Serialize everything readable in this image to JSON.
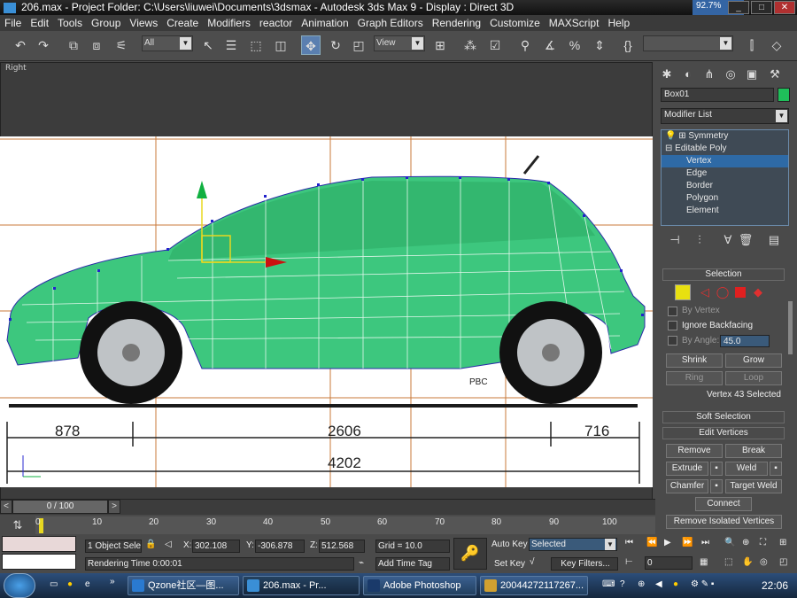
{
  "window": {
    "title": "206.max   - Project Folder: C:\\Users\\liuwei\\Documents\\3dsmax     - Autodesk 3ds Max 9      - Display : Direct 3D",
    "percent": "92.7%"
  },
  "menu": [
    "File",
    "Edit",
    "Tools",
    "Group",
    "Views",
    "Create",
    "Modifiers",
    "reactor",
    "Animation",
    "Graph Editors",
    "Rendering",
    "Customize",
    "MAXScript",
    "Help"
  ],
  "toolbar": {
    "filter": "All",
    "ref_coord": "View"
  },
  "viewport": {
    "label": "Right",
    "dimensions": {
      "front": "878",
      "wheelbase": "2606",
      "rear": "716",
      "total": "4202"
    },
    "plate": "PBC"
  },
  "panel": {
    "object_name": "Box01",
    "object_color": "#1fbf5a",
    "modifier_list": "Modifier List",
    "stack": [
      {
        "label": "Symmetry"
      },
      {
        "label": "Editable Poly"
      },
      {
        "label": "Vertex"
      },
      {
        "label": "Edge"
      },
      {
        "label": "Border"
      },
      {
        "label": "Polygon"
      },
      {
        "label": "Element"
      }
    ],
    "selection_title": "Selection",
    "by_vertex": "By Vertex",
    "ignore_backfacing": "Ignore Backfacing",
    "by_angle": "By Angle:",
    "angle_value": "45.0",
    "shrink": "Shrink",
    "grow": "Grow",
    "ring": "Ring",
    "loop": "Loop",
    "selected_count": "Vertex 43 Selected",
    "soft_selection": "Soft Selection",
    "edit_vertices": "Edit Vertices",
    "remove": "Remove",
    "break": "Break",
    "extrude": "Extrude",
    "weld": "Weld",
    "chamfer": "Chamfer",
    "target_weld": "Target Weld",
    "connect": "Connect",
    "remove_isolated": "Remove Isolated Vertices"
  },
  "timeline": {
    "frame": "0 / 100",
    "ticks": [
      "0",
      "10",
      "20",
      "30",
      "40",
      "50",
      "60",
      "70",
      "80",
      "90",
      "100"
    ]
  },
  "status": {
    "selection": "1 Object Sele",
    "x_label": "X:",
    "x": "302.108",
    "y_label": "Y:",
    "y": "-306.878",
    "z_label": "Z:",
    "z": "512.568",
    "grid": "Grid = 10.0",
    "render_time": "Rendering Time  0:00:01",
    "add_time_tag": "Add Time Tag",
    "auto_key": "Auto Key",
    "set_key": "Set Key",
    "key_mode": "Selected",
    "key_filters": "Key Filters...",
    "frame_value": "0"
  },
  "taskbar": {
    "tasks": [
      "Qzone社区—图...",
      "206.max    - Pr...",
      "Adobe Photoshop",
      "20044272117267..."
    ],
    "clock": "22:06"
  }
}
